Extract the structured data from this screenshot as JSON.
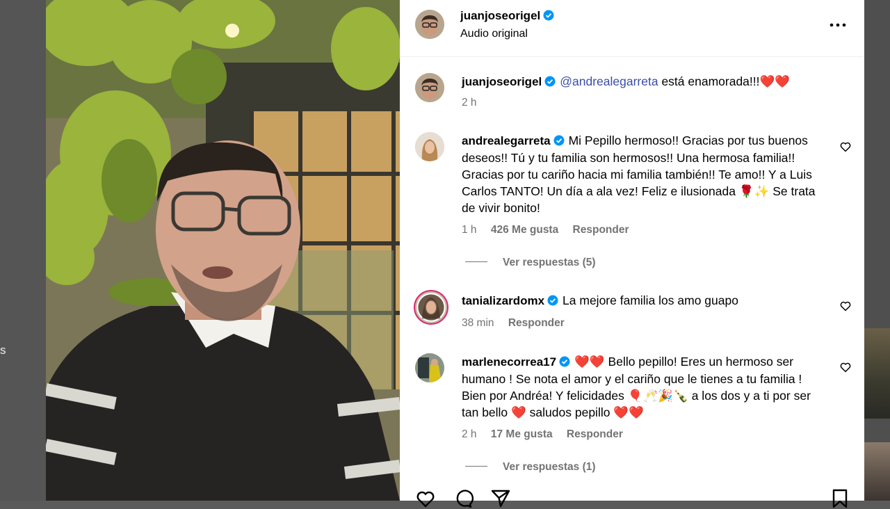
{
  "background": {
    "left_text": "s"
  },
  "post": {
    "author": "juanjoseorigel",
    "audio": "Audio original",
    "caption": {
      "username": "juanjoseorigel",
      "mention": "@andrealegarreta",
      "text": " está enamorada!!!❤️❤️",
      "time": "2 h"
    }
  },
  "comments": [
    {
      "username": "andrealegarreta",
      "text": "Mi Pepillo hermoso!! Gracias por tus buenos deseos!! Tú y tu familia son hermosos!! Una hermosa familia!! Gracias por tu cariño hacia mi familia también!! Te amo!! Y a Luis Carlos TANTO! Un día a ala vez! Feliz e ilusionada 🌹✨ Se trata de vivir bonito!",
      "time": "1 h",
      "likes": "426 Me gusta",
      "reply": "Responder",
      "view_replies": "Ver respuestas (5)"
    },
    {
      "username": "tanializardomx",
      "text": "La mejore familia los amo guapo",
      "time": "38 min",
      "reply": "Responder"
    },
    {
      "username": "marlenecorrea17",
      "text": "❤️❤️ Bello pepillo! Eres un hermoso ser humano ! Se nota el amor y el cariño que le tienes a tu familia ! Bien por Andréa! Y felicidades 🎈🥂🎉🍾 a los dos y a ti por ser tan bello ❤️ saludos pepillo ❤️❤️",
      "time": "2 h",
      "likes": "17 Me gusta",
      "reply": "Responder",
      "view_replies": "Ver respuestas (1)"
    }
  ],
  "icons": {
    "verified": "verified-badge-icon",
    "more": "more-options-icon",
    "like": "heart-icon",
    "comment": "comment-icon",
    "share": "share-icon",
    "save": "bookmark-icon"
  },
  "colors": {
    "verified": "#0095f6",
    "mention": "#3a4ea6",
    "muted": "#737373"
  }
}
